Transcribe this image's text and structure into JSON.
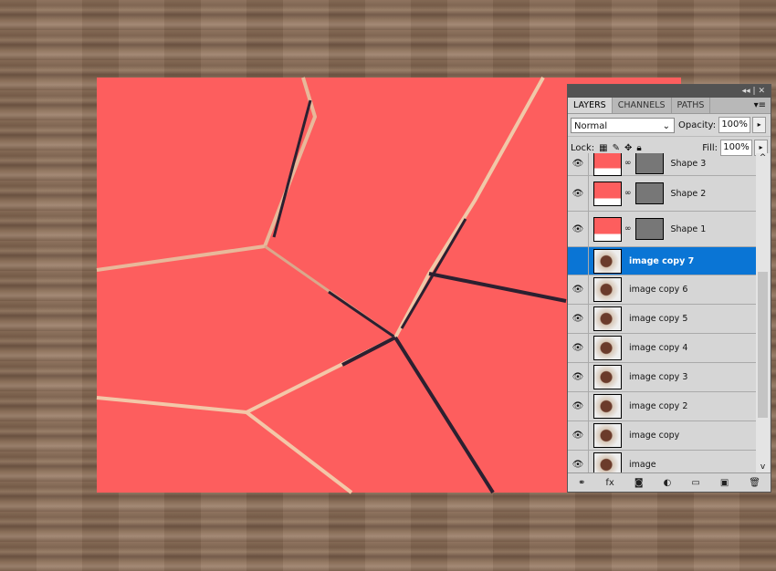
{
  "panel": {
    "tabs": [
      "LAYERS",
      "CHANNELS",
      "PATHS"
    ],
    "blend_mode": "Normal",
    "opacity_label": "Opacity:",
    "opacity": "100%",
    "lock_label": "Lock:",
    "fill_label": "Fill:",
    "fill": "100%",
    "layers": [
      {
        "name": "Shape 3",
        "type": "shape",
        "visible": true
      },
      {
        "name": "Shape 2",
        "type": "shape",
        "visible": true
      },
      {
        "name": "Shape 1",
        "type": "shape",
        "visible": true
      },
      {
        "name": "image copy 7",
        "type": "image",
        "visible": true,
        "selected": true
      },
      {
        "name": "image copy 6",
        "type": "image",
        "visible": true
      },
      {
        "name": "image copy 5",
        "type": "image",
        "visible": true
      },
      {
        "name": "image copy 4",
        "type": "image",
        "visible": true
      },
      {
        "name": "image copy 3",
        "type": "image",
        "visible": true
      },
      {
        "name": "image copy 2",
        "type": "image",
        "visible": true
      },
      {
        "name": "image copy",
        "type": "image",
        "visible": true
      },
      {
        "name": "image",
        "type": "image",
        "visible": true
      }
    ],
    "footer_icons": [
      "link-icon",
      "fx-icon",
      "mask-icon",
      "adjustment-icon",
      "folder-icon",
      "new-layer-icon",
      "trash-icon"
    ]
  },
  "colors": {
    "artboard": "#fd5e5e",
    "selection": "#0a75d5"
  }
}
